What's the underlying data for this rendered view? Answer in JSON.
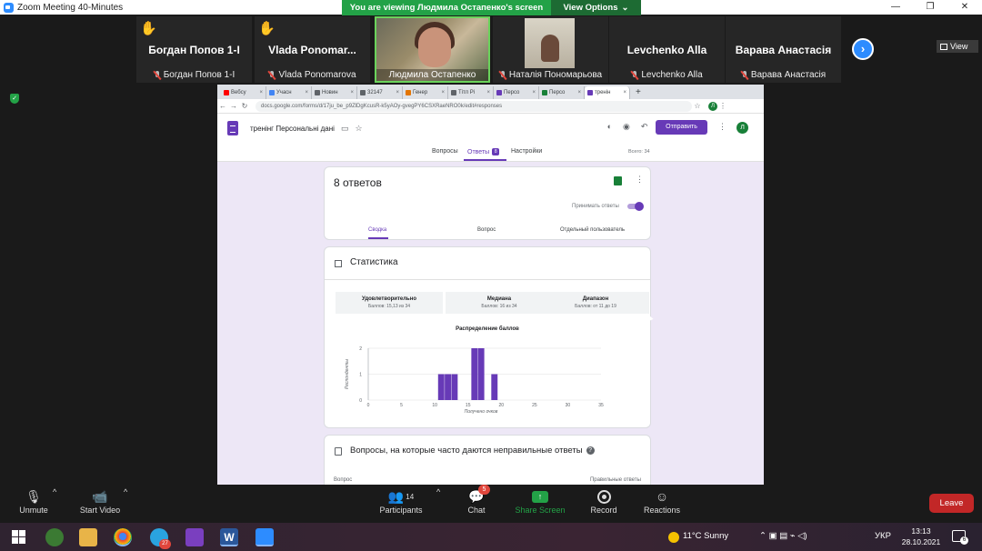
{
  "window": {
    "title": "Zoom Meeting 40-Minutes",
    "controls": [
      "—",
      "❐",
      "✕"
    ]
  },
  "banner": {
    "text": "You are viewing Людмила Остапенко's screen",
    "view_options": "View Options"
  },
  "view_button": "View",
  "participants": [
    {
      "big_name": "Богдан Попов 1-І",
      "label": "Богдан Попов 1-І",
      "hand": true
    },
    {
      "big_name": "Vlada Ponomar...",
      "label": "Vlada Ponomarova",
      "hand": true
    },
    {
      "big_name": "",
      "label": "Людмила Остапенко",
      "hand": false,
      "video": true
    },
    {
      "big_name": "",
      "label": "Наталія Пономарьова",
      "hand": false,
      "video": true
    },
    {
      "big_name": "Levchenko Alla",
      "label": "Levchenko Alla",
      "hand": false
    },
    {
      "big_name": "Варава Анастасія",
      "label": "Варава Анастасія",
      "hand": false
    }
  ],
  "browser": {
    "tabs": [
      {
        "label": "Вебсу",
        "color": "#ff0000"
      },
      {
        "label": "Учасн",
        "color": "#4285f4"
      },
      {
        "label": "Новин",
        "color": "#5f6368"
      },
      {
        "label": "32147",
        "color": "#5f6368"
      },
      {
        "label": "Генер",
        "color": "#e37400"
      },
      {
        "label": "Тітл Рі",
        "color": "#5f6368"
      },
      {
        "label": "Персо",
        "color": "#673ab7"
      },
      {
        "label": "Персо",
        "color": "#188038"
      },
      {
        "label": "тренін",
        "color": "#673ab7"
      }
    ],
    "new_tab": "+",
    "url": "docs.google.com/forms/d/17ju_be_p9ZlDgKcusR-k5yAOy-gvegPY6CSXRaeNRO0k/edit#responses",
    "avatar": "Л"
  },
  "form": {
    "title": "тренінг Персональні дані",
    "send_label": "Отправить",
    "avatar": "Л",
    "tabs": {
      "questions": "Вопросы",
      "responses": "Ответы",
      "responses_count": "8",
      "settings": "Настройки"
    },
    "total": "Всего: 34",
    "responses_card": {
      "count": "8 ответов",
      "accept_label": "Принимать ответы",
      "subtabs": [
        "Сводка",
        "Вопрос",
        "Отдельный пользователь"
      ]
    },
    "stats_card": {
      "title": "Статистика",
      "boxes": [
        {
          "label": "Удовлетворительно",
          "value": "Баллов: 15,13 из 34"
        },
        {
          "label": "Медиана",
          "value": "Баллов: 16 из 34"
        },
        {
          "label": "Диапазон",
          "value": "Баллов: от 11 до 19"
        }
      ],
      "chart_title": "Распределение баллов"
    },
    "wrong_card": {
      "title": "Вопросы, на которые часто даются неправильные ответы",
      "col_question": "Вопрос",
      "col_correct": "Правильные ответы"
    }
  },
  "chart_data": {
    "type": "bar",
    "title": "Распределение баллов",
    "xlabel": "Получено очков",
    "ylabel": "Респонденты",
    "x": [
      11,
      12,
      13,
      16,
      17,
      19
    ],
    "values": [
      1,
      1,
      1,
      2,
      2,
      1
    ],
    "xlim": [
      0,
      35
    ],
    "ylim": [
      0,
      2
    ],
    "xticks": [
      "0",
      "5",
      "10",
      "15",
      "20",
      "25",
      "30",
      "35"
    ],
    "yticks": [
      "0",
      "1",
      "2"
    ],
    "bar_color": "#673ab7",
    "grid": true
  },
  "controls": {
    "unmute": "Unmute",
    "start_video": "Start Video",
    "participants": "Participants",
    "participants_count": "14",
    "chat": "Chat",
    "chat_badge": "5",
    "share_screen": "Share Screen",
    "record": "Record",
    "reactions": "Reactions",
    "leave": "Leave"
  },
  "taskbar": {
    "weather": "11°C  Sunny",
    "lang": "УКР",
    "time": "13:13",
    "date": "28.10.2021",
    "notif_count": "6",
    "telegram_badge": "27"
  }
}
